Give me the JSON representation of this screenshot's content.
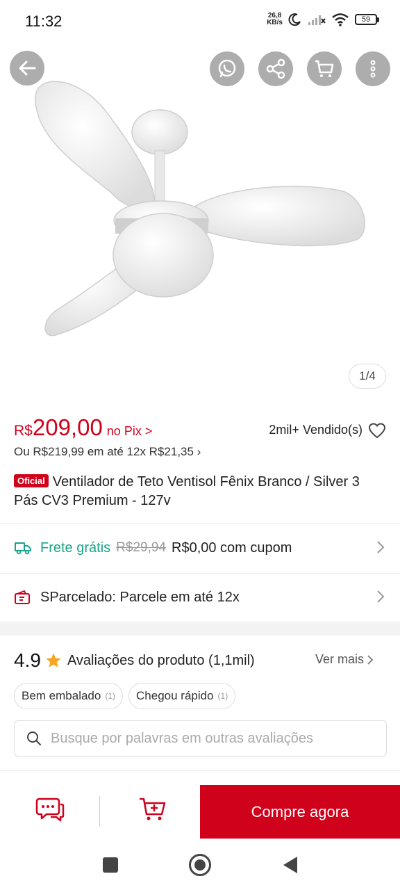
{
  "status_bar": {
    "time": "11:32",
    "net_speed_value": "26,8",
    "net_speed_unit": "KB/s",
    "battery": "59",
    "icons": [
      "moon-icon",
      "signal-icon",
      "wifi-icon",
      "battery-icon"
    ]
  },
  "gallery": {
    "counter": "1/4",
    "actions": [
      "back-arrow-icon",
      "whatsapp-icon",
      "share-icon",
      "cart-icon",
      "more-vertical-icon"
    ]
  },
  "price": {
    "currency": "R$",
    "value": "209,00",
    "pix_label": "no Pix >",
    "sold": "2mil+ Vendido(s)",
    "installment": "Ou R$219,99 em até 12x R$21,35 ›"
  },
  "product": {
    "badge": "Oficial",
    "title": "Ventilador de Teto Ventisol Fênix Branco / Silver 3 Pás CV3 Premium - 127v"
  },
  "shipping": {
    "free_label": "Frete grátis",
    "old_price": "R$29,94",
    "coupon_text": "R$0,00 com cupom"
  },
  "installments_row": {
    "label": "SParcelado: Parcele em até 12x"
  },
  "reviews": {
    "score": "4.9",
    "title": "Avaliações do produto (1,1mil)",
    "see_more": "Ver mais",
    "chips": [
      {
        "label": "Bem embalado",
        "count": "(1)"
      },
      {
        "label": "Chegou rápido",
        "count": "(1)"
      }
    ],
    "search_placeholder": "Busque por palavras em outras avaliações"
  },
  "bottom_bar": {
    "buy_label": "Compre agora"
  },
  "colors": {
    "accent": "#d0011b",
    "shipping_green": "#1aa38a",
    "star": "#f5a623"
  }
}
